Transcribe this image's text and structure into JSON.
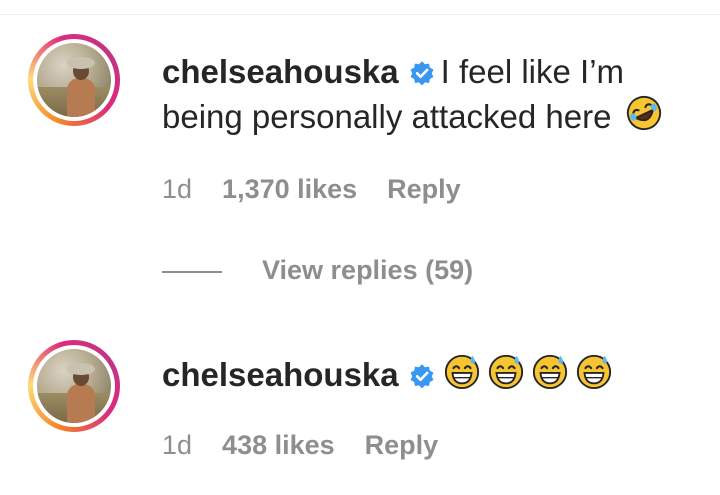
{
  "comments": [
    {
      "username": "chelseahouska",
      "text_line1": "I feel like I’m",
      "text_line2": "being personally attacked here",
      "emoji": "rolling-on-floor-laughing",
      "time": "1d",
      "likes": "1,370 likes",
      "reply": "Reply",
      "view_replies": "View replies (59)"
    },
    {
      "username": "chelseahouska",
      "text_line1": "",
      "emoji": "grinning-face-with-sweat",
      "emoji_count": 4,
      "time": "1d",
      "likes": "438 likes",
      "reply": "Reply"
    }
  ],
  "colors": {
    "text": "#262626",
    "meta": "#8e8e8e",
    "verified": "#3897f0",
    "emoji_face": "#f7c531"
  }
}
